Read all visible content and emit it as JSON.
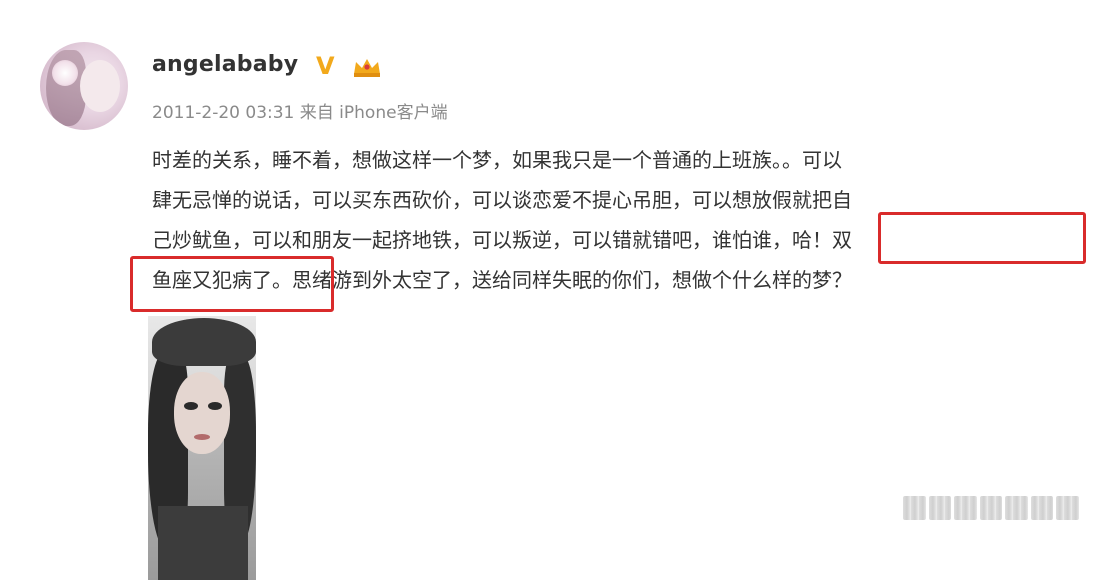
{
  "post": {
    "username": "angelababy",
    "verified_badge": "V",
    "badge_icon": "crown-icon",
    "timestamp": "2011-2-20 03:31",
    "source": "来自 iPhone客户端",
    "lines": [
      "时差的关系，睡不着，想做这样一个梦，如果我只是一个普通的上班族。。可以",
      "肆无忌惮的说话，可以买东西砍价，可以谈恋爱不提心吊胆，可以想放假就把自",
      "己炒鱿鱼，可以和朋友一起挤地铁，可以叛逆，可以错就错吧，谁怕谁，哈！双",
      "鱼座又犯病了。思绪游到外太空了，送给同样失眠的你们，想做个什么样的梦？"
    ],
    "photo_icon": "portrait-photo"
  },
  "colors": {
    "highlight": "#d92b2b",
    "verified": "#f2a91c",
    "text": "#333333",
    "meta": "#8a8a8a"
  }
}
